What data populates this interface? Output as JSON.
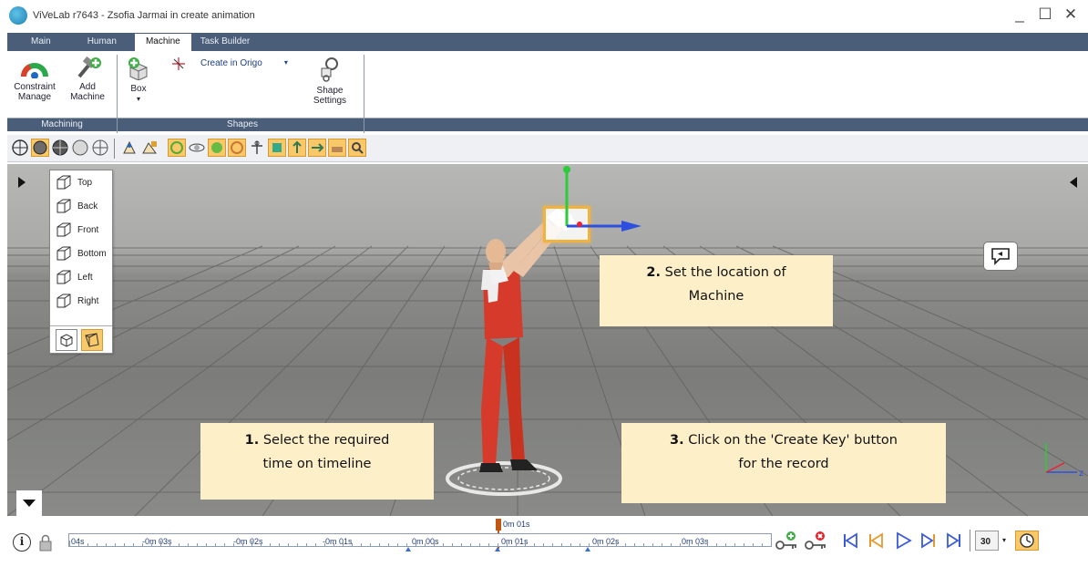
{
  "window": {
    "title": "ViVeLab r7643 - Zsofia Jarmai in create animation",
    "minimize": "_",
    "maximize": "☐",
    "close": "✕"
  },
  "ribbon": {
    "tabs": [
      "Main",
      "Human",
      "Machine",
      "Task Builder"
    ],
    "active_tab": "Machine",
    "buttons": {
      "constraint_manage": [
        "Constraint",
        "Manage"
      ],
      "add_machine": [
        "Add",
        "Machine"
      ],
      "box": "Box",
      "box_arrow": "▾",
      "create_in_origo": "Create in Origo",
      "create_in_origo_arrow": "▾",
      "shape_settings": [
        "Shape",
        "Settings"
      ]
    },
    "groups": [
      "Machining",
      "Shapes"
    ]
  },
  "view_panel": {
    "items": [
      "Top",
      "Back",
      "Front",
      "Bottom",
      "Left",
      "Right"
    ]
  },
  "callouts": {
    "step2": {
      "num": "2.",
      "line1": " Set the location of",
      "line2": "Machine"
    },
    "step1": {
      "num": "1.",
      "line1": " Select the required",
      "line2": "time on timeline"
    },
    "step3": {
      "num": "3.",
      "line1": " Click on the 'Create Key' button",
      "line2": "for the record"
    }
  },
  "timeline": {
    "labels": [
      "04s",
      "-0m 03s",
      "-0m 02s",
      "-0m 01s",
      "0m 00s",
      "0m 01s",
      "0m 02s",
      "0m 03s"
    ],
    "current_time": "0m 01s",
    "fps": "30"
  },
  "colors": {
    "ribbon_dark": "#4a5d79",
    "callout_bg": "#fdefc8",
    "accent_orange": "#f9c869",
    "time_cursor": "#c05713"
  }
}
